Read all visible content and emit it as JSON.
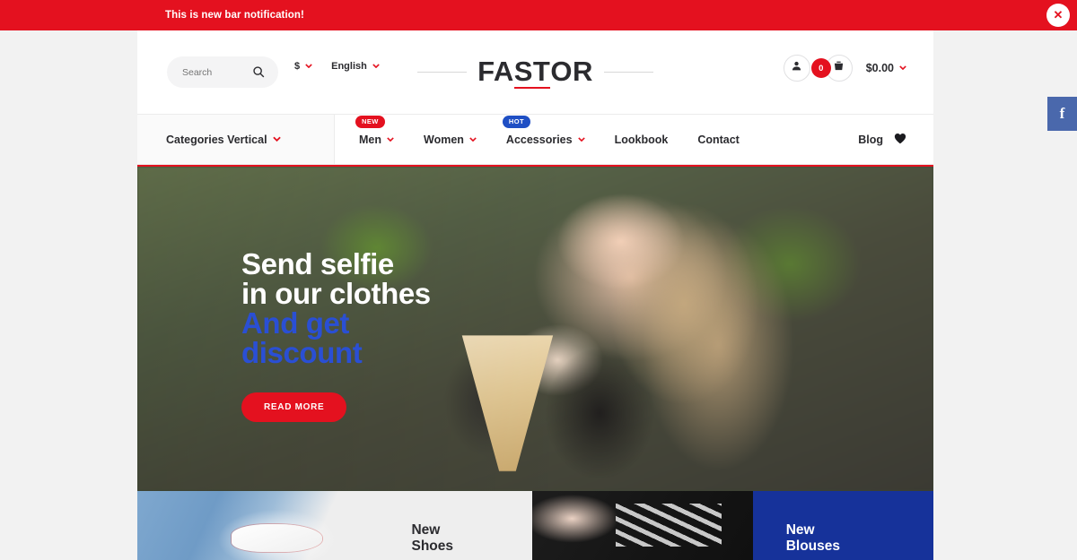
{
  "notification": {
    "text": "This is new bar notification!",
    "close_label": "✕",
    "bar_color": "#e4111f"
  },
  "social": {
    "facebook_label": "f",
    "color": "#4a68ac"
  },
  "header": {
    "search": {
      "placeholder": "Search",
      "value": "",
      "icon": "search-icon"
    },
    "currency": {
      "label": "$",
      "chevron": "⌄"
    },
    "language": {
      "label": "English",
      "chevron": "⌄"
    },
    "logo": {
      "part1": "FA",
      "part2": "ST",
      "part3": "OR"
    },
    "account_icon": "user-icon",
    "cart": {
      "icon": "basket-icon",
      "count": "0",
      "total": "$0.00",
      "chevron": "⌄"
    }
  },
  "nav": {
    "categories": {
      "label": "Categories Vertical",
      "chevron": "⌄"
    },
    "items": [
      {
        "label": "Men",
        "badge": "NEW",
        "badge_type": "new",
        "chevron": "⌄"
      },
      {
        "label": "Women",
        "badge": "",
        "badge_type": "",
        "chevron": "⌄"
      },
      {
        "label": "Accessories",
        "badge": "HOT",
        "badge_type": "hot",
        "chevron": "⌄"
      },
      {
        "label": "Lookbook",
        "badge": "",
        "badge_type": "",
        "chevron": ""
      },
      {
        "label": "Contact",
        "badge": "",
        "badge_type": "",
        "chevron": ""
      }
    ],
    "blog": {
      "label": "Blog",
      "icon": "heart-icon"
    }
  },
  "hero": {
    "line1": "Send selfie",
    "line2": "in our clothes",
    "line3": "And get",
    "line4": "discount",
    "button": "READ MORE",
    "white_color": "#ffffff",
    "blue_color": "#2a4fd4",
    "button_color": "#e4111f"
  },
  "promos": [
    {
      "line1": "New",
      "line2": "Shoes",
      "bg": "#eeeeee",
      "text_color": "#2b2b2f"
    },
    {
      "line1": "New",
      "line2": "Blouses",
      "bg": "#16329a",
      "text_color": "#ffffff"
    }
  ]
}
